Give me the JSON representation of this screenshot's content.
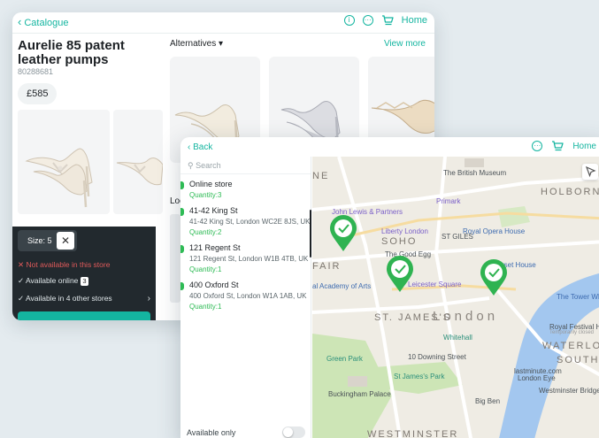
{
  "catalogue": {
    "back_label": "Catalogue",
    "home_label": "Home",
    "product": {
      "title": "Aurelie 85 patent leather pumps",
      "code": "80288681",
      "price": "£585"
    },
    "size": {
      "label": "Size: 5"
    },
    "availability": {
      "not_in_store": "Not available in this store",
      "online": "Available online",
      "online_count": "3",
      "other_stores": "Available in 4 other stores"
    },
    "alternatives": {
      "label": "Alternatives",
      "view_more": "View more"
    },
    "location_peek": "Loc"
  },
  "locator": {
    "back_label": "Back",
    "home_label": "Home",
    "search_placeholder": "Search",
    "stores": [
      {
        "name": "Online store",
        "address": "",
        "quantity": "Quantity:3"
      },
      {
        "name": "41-42 King St",
        "address": "41-42 King St, London WC2E 8JS, UK",
        "quantity": "Quantity:2"
      },
      {
        "name": "121 Regent St",
        "address": "121 Regent St, London W1B 4TB, UK",
        "quantity": "Quantity:1"
      },
      {
        "name": "400 Oxford St",
        "address": "400 Oxford St, London W1A 1AB, UK",
        "quantity": "Quantity:1"
      }
    ],
    "available_only_label": "Available only",
    "available_only": false
  },
  "map": {
    "labels": {
      "british_museum": "The British Museum",
      "holborn": "HOLBORN",
      "primark": "Primark",
      "john_lewis": "John Lewis & Partners",
      "liberty": "Liberty London",
      "soho": "SOHO",
      "st_giles": "ST GILES",
      "royal_opera": "Royal Opera House",
      "good_egg": "The Good Egg",
      "fair": "FAIR",
      "academy": "al Academy of Arts",
      "leicester": "Leicester Square",
      "somerset": "rset House",
      "st_james": "ST. JAMES'S",
      "london": "London",
      "tower_whi": "The Tower Whi",
      "festival": "Royal Festival Ha",
      "festival_sub": "Temporarily closed",
      "waterloo": "WATERLOO",
      "south_ba": "SOUTH BA",
      "whitehall": "Whitehall",
      "green_park": "Green Park",
      "downing": "10 Downing Street",
      "lastminute": "lastminute.com",
      "london_eye": "London Eye",
      "st_james_park": "St James's Park",
      "westminster_bridge": "Westminster Bridge",
      "buckingham": "Buckingham Palace",
      "big_ben": "Big Ben",
      "westminster": "WESTMINSTER",
      "ne": "NE"
    },
    "pin_color": "#2fb351",
    "water_color": "#9dc3ee",
    "park_color": "#c9e2b4"
  },
  "colors": {
    "accent": "#14b5a0",
    "dark_panel": "#22292e",
    "not_available": "#e05a5a",
    "quantity": "#2ebb55"
  }
}
